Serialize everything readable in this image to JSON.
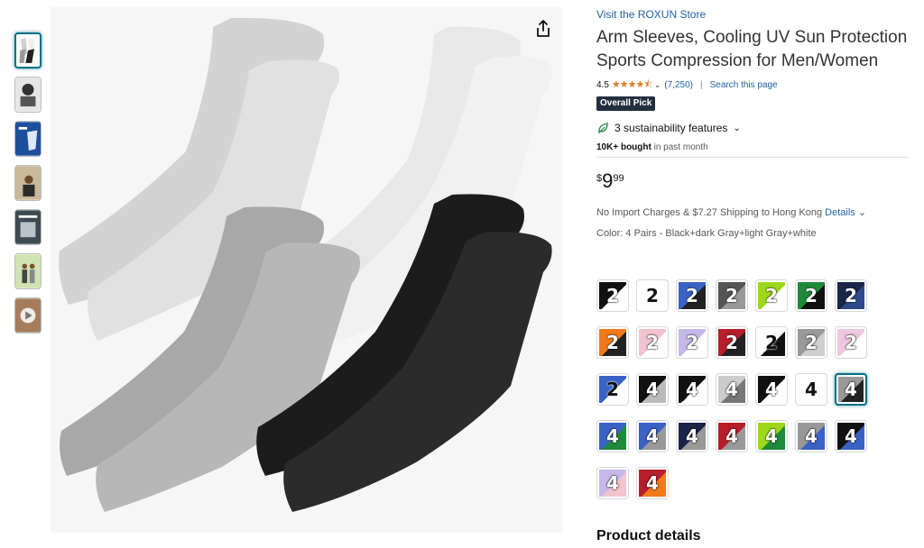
{
  "store_link": "Visit the ROXUN Store",
  "title": "Arm Sleeves, Cooling UV Sun Protection Sports Compression for Men/Women",
  "rating": {
    "value": "4.5",
    "stars": "★★★★⯪",
    "count": "(7,250)",
    "separator": "|",
    "search_page": "Search this page"
  },
  "badge": "Overall Pick",
  "sustainability": "3 sustainability features",
  "bought": {
    "bold": "10K+ bought",
    "rest": " in past month"
  },
  "price": {
    "symbol": "$",
    "whole": "9",
    "fraction": "99"
  },
  "shipping": {
    "text": "No Import Charges & $7.27 Shipping to Hong Kong ",
    "details": "Details"
  },
  "color": {
    "label": "Color: 4 Pairs - Black+dark Gray+light Gray+white"
  },
  "swatch_rows": [
    [
      {
        "n": "2",
        "c1": "#111111",
        "c2": "#ffffff"
      },
      {
        "n": "2",
        "c1": "#ffffff",
        "c2": "#ffffff",
        "dark": true
      },
      {
        "n": "2",
        "c1": "#3a62c4",
        "c2": "#222222"
      },
      {
        "n": "2",
        "c1": "#555555",
        "c2": "#999999"
      },
      {
        "n": "2",
        "c1": "#9ed81c",
        "c2": "#ffffff"
      },
      {
        "n": "2",
        "c1": "#1f8a3a",
        "c2": "#111111"
      },
      {
        "n": "2",
        "c1": "#1a2548",
        "c2": "#2f4a8a"
      }
    ],
    [
      {
        "n": "2",
        "c1": "#f07a1a",
        "c2": "#222222"
      },
      {
        "n": "2",
        "c1": "#f2c4cf",
        "c2": "#ffffff"
      },
      {
        "n": "2",
        "c1": "#c7b8ea",
        "c2": "#ffffff"
      },
      {
        "n": "2",
        "c1": "#b81d2a",
        "c2": "#222222"
      },
      {
        "n": "2",
        "c1": "#ffffff",
        "c2": "#111111",
        "dark": true
      },
      {
        "n": "2",
        "c1": "#9a9a9a",
        "c2": "#cfcfcf"
      },
      {
        "n": "2",
        "c1": "#efc7e0",
        "c2": "#ffffff"
      }
    ],
    [
      {
        "n": "2",
        "c1": "#3a62c4",
        "c2": "#ffffff",
        "dark": true
      },
      {
        "n": "4",
        "c1": "#111111",
        "c2": "#bbbbbb"
      },
      {
        "n": "4",
        "c1": "#111111",
        "c2": "#ffffff"
      },
      {
        "n": "4",
        "c1": "#cccccc",
        "c2": "#777777"
      },
      {
        "n": "4",
        "c1": "#111111",
        "c2": "#ffffff"
      },
      {
        "n": "4",
        "c1": "#ffffff",
        "c2": "#ffffff",
        "dark": true
      },
      {
        "n": "4",
        "c1": "#999999",
        "c2": "#222222"
      }
    ],
    [
      {
        "n": "4",
        "c1": "#3a62c4",
        "c2": "#1f8a3a"
      },
      {
        "n": "4",
        "c1": "#3a62c4",
        "c2": "#999999"
      },
      {
        "n": "4",
        "c1": "#1a2548",
        "c2": "#999999"
      },
      {
        "n": "4",
        "c1": "#b81d2a",
        "c2": "#999999"
      },
      {
        "n": "4",
        "c1": "#9ed81c",
        "c2": "#1f8a3a"
      },
      {
        "n": "4",
        "c1": "#999999",
        "c2": "#3a62c4"
      },
      {
        "n": "4",
        "c1": "#111111",
        "c2": "#3a62c4"
      }
    ],
    [
      {
        "n": "4",
        "c1": "#c7b8ea",
        "c2": "#f2c4cf"
      },
      {
        "n": "4",
        "c1": "#b81d2a",
        "c2": "#f07a1a"
      }
    ]
  ],
  "selected_swatch": "2-6",
  "product_details": "Product details",
  "icons": {
    "share": "share-icon",
    "leaf": "leaf-icon",
    "chevron": "chevron-down-icon"
  },
  "colors": {
    "link": "#2162a1",
    "badge_bg": "#232f3e",
    "star": "#de7921",
    "selected_border": "#007185"
  }
}
